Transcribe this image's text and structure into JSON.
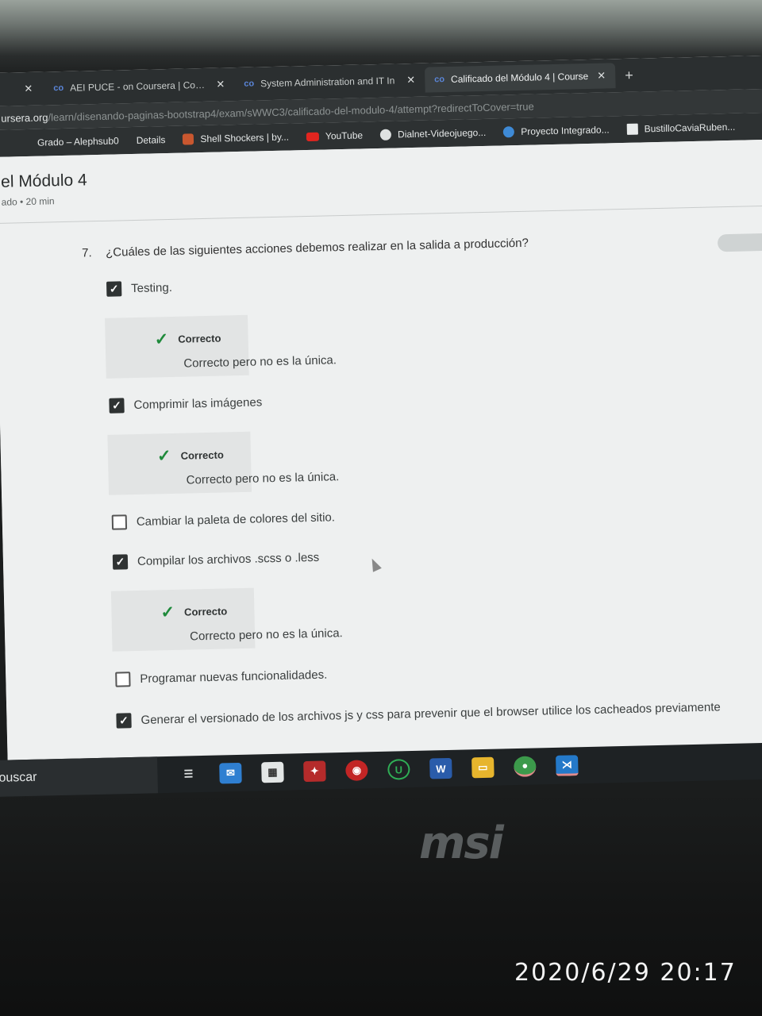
{
  "browser": {
    "tabs": [
      {
        "title": "AEI PUCE - on Coursera | Cours",
        "active": false
      },
      {
        "title": "System Administration and IT In",
        "active": false
      },
      {
        "title": "Calificado del Módulo 4 | Course",
        "active": true
      }
    ],
    "new_tab": "+",
    "address": {
      "host": "ursera.org",
      "path": "/learn/disenando-paginas-bootstrap4/exam/sWWC3/calificado-del-modulo-4/attempt?redirectToCover=true"
    },
    "bookmarks": [
      {
        "label": "Grado – Alephsub0",
        "icon": "none"
      },
      {
        "label": "Details",
        "icon": "none"
      },
      {
        "label": "Shell Shockers | by...",
        "icon": "shell"
      },
      {
        "label": "YouTube",
        "icon": "yt"
      },
      {
        "label": "Dialnet-Videojuego...",
        "icon": "dial"
      },
      {
        "label": "Proyecto Integrado...",
        "icon": "proj"
      },
      {
        "label": "BustilloCaviaRuben...",
        "icon": "uc"
      }
    ]
  },
  "page": {
    "title": "el Módulo 4",
    "meta": "ado • 20 min"
  },
  "question": {
    "number": "7.",
    "text": "¿Cuáles de las siguientes acciones debemos realizar en la salida a producción?"
  },
  "options": [
    {
      "label": "Testing.",
      "checked": true
    },
    {
      "label": "Comprimir las imágenes",
      "checked": true
    },
    {
      "label": "Cambiar la paleta de colores del sitio.",
      "checked": false
    },
    {
      "label": "Compilar los archivos .scss o .less",
      "checked": true
    },
    {
      "label": "Programar nuevas funcionalidades.",
      "checked": false
    },
    {
      "label": "Generar el versionado de los archivos js y css para prevenir que el browser utilice los cacheados previamente",
      "checked": true
    }
  ],
  "feedback": {
    "status": "Correcto",
    "text": "Correcto pero no es la única."
  },
  "taskbar": {
    "search_label": "ouscar",
    "icons": [
      "task-view",
      "mail",
      "store",
      "game",
      "antivirus",
      "upwork",
      "word",
      "files",
      "chrome",
      "vscode"
    ]
  },
  "monitor_brand": "msi",
  "photo_timestamp": "2020/6/29  20:17"
}
